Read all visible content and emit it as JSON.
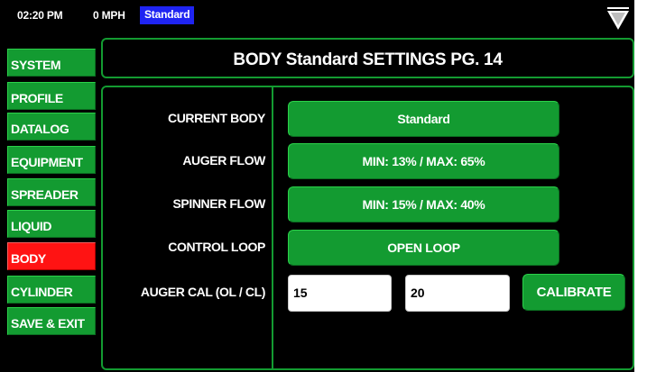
{
  "status": {
    "time": "02:20 PM",
    "speed": "0 MPH",
    "profile": "Standard",
    "menu_icon": "down-triangle-icon"
  },
  "sidebar": {
    "items": [
      {
        "label": "SYSTEM",
        "active": false
      },
      {
        "label": "PROFILE",
        "active": false
      },
      {
        "label": "DATALOG",
        "active": false
      },
      {
        "label": "EQUIPMENT",
        "active": false
      },
      {
        "label": "SPREADER",
        "active": false
      },
      {
        "label": "LIQUID",
        "active": false
      },
      {
        "label": "BODY",
        "active": true
      },
      {
        "label": "CYLINDER",
        "active": false
      },
      {
        "label": "SAVE & EXIT",
        "active": false
      }
    ]
  },
  "header": {
    "title": "BODY Standard SETTINGS PG. 14"
  },
  "settings": {
    "current_body": {
      "label": "CURRENT BODY",
      "value": "Standard"
    },
    "auger_flow": {
      "label": "AUGER FLOW",
      "value": "MIN: 13% / MAX: 65%"
    },
    "spinner_flow": {
      "label": "SPINNER FLOW",
      "value": "MIN: 15% / MAX: 40%"
    },
    "control_loop": {
      "label": "CONTROL LOOP",
      "value": "OPEN LOOP"
    },
    "auger_cal": {
      "label": "AUGER CAL (OL / CL)",
      "ol_value": "15",
      "cl_value": "20",
      "button_label": "CALIBRATE"
    }
  },
  "colors": {
    "background": "#000000",
    "green": "#139b31",
    "active_red": "#ff1313",
    "status_blue": "#1f24f2",
    "text": "#ffffff"
  }
}
